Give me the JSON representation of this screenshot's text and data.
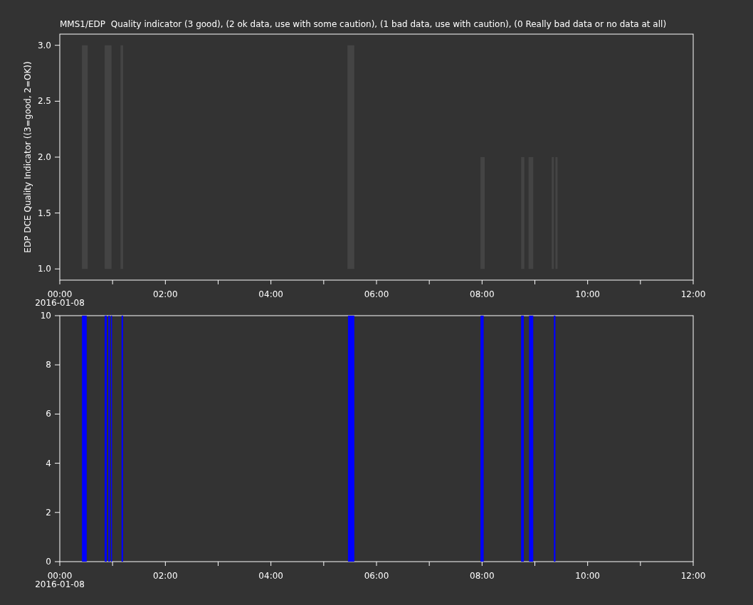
{
  "title": "MMS1/EDP  Quality indicator (3 good), (2 ok data, use with some caution), (1 bad data, use with caution), (0 Really bad data or no data at all)",
  "panels": [
    {
      "date_label": "2016-01-08",
      "chart_data": {
        "type": "area",
        "ylabel": "EDP DCE Quality Indicator ((3=good, 2=OK))",
        "x": [
          0.42,
          0.53,
          null,
          0.85,
          0.98,
          null,
          1.15,
          1.2,
          null,
          5.45,
          5.58,
          null,
          7.97,
          8.05,
          null,
          8.74,
          8.8,
          null,
          8.88,
          8.97,
          null,
          9.32,
          9.36,
          null,
          9.39,
          9.43
        ],
        "series": [
          {
            "color": "#444444",
            "values": [
              3,
              3,
              null,
              3,
              3,
              null,
              3,
              3,
              null,
              3,
              3,
              null,
              2,
              2,
              null,
              2,
              2,
              null,
              2,
              2,
              null,
              2,
              2,
              null,
              2,
              2
            ]
          }
        ],
        "xlim": [
          0,
          12
        ],
        "ylim": [
          0.9,
          3.1
        ],
        "xticks": [
          {
            "value": 0,
            "label": "00:00"
          },
          {
            "value": 2,
            "label": "02:00"
          },
          {
            "value": 4,
            "label": "04:00"
          },
          {
            "value": 6,
            "label": "06:00"
          },
          {
            "value": 8,
            "label": "08:00"
          },
          {
            "value": 10,
            "label": "10:00"
          },
          {
            "value": 12,
            "label": "12:00"
          }
        ],
        "yticks": [
          {
            "value": 1,
            "label": "1.0"
          },
          {
            "value": 1.5,
            "label": "1.5"
          },
          {
            "value": 2,
            "label": "2.0"
          },
          {
            "value": 2.5,
            "label": "2.5"
          },
          {
            "value": 3,
            "label": "3.0"
          }
        ]
      }
    },
    {
      "date_label": "2016-01-08",
      "chart_data": {
        "type": "area",
        "x": [
          0.42,
          0.51,
          null,
          0.85,
          0.89,
          null,
          0.92,
          0.95,
          null,
          0.97,
          0.99,
          null,
          1.17,
          1.2,
          null,
          5.46,
          5.58,
          null,
          7.97,
          8.03,
          null,
          8.74,
          8.79,
          null,
          8.89,
          8.97,
          null,
          9.36,
          9.39
        ],
        "series": [
          {
            "color": "#0000ff",
            "values": [
              10,
              10,
              null,
              10,
              10,
              null,
              10,
              10,
              null,
              10,
              10,
              null,
              10,
              10,
              null,
              10,
              10,
              null,
              10,
              10,
              null,
              10,
              10,
              null,
              10,
              10,
              null,
              10,
              10
            ]
          }
        ],
        "xlim": [
          0,
          12
        ],
        "ylim": [
          0,
          10
        ],
        "xticks": [
          {
            "value": 0,
            "label": "00:00"
          },
          {
            "value": 2,
            "label": "02:00"
          },
          {
            "value": 4,
            "label": "04:00"
          },
          {
            "value": 6,
            "label": "06:00"
          },
          {
            "value": 8,
            "label": "08:00"
          },
          {
            "value": 10,
            "label": "10:00"
          },
          {
            "value": 12,
            "label": "12:00"
          }
        ],
        "yticks": [
          {
            "value": 0,
            "label": "0"
          },
          {
            "value": 2,
            "label": "2"
          },
          {
            "value": 4,
            "label": "4"
          },
          {
            "value": 6,
            "label": "6"
          },
          {
            "value": 8,
            "label": "8"
          },
          {
            "value": 10,
            "label": "10"
          }
        ]
      }
    }
  ]
}
